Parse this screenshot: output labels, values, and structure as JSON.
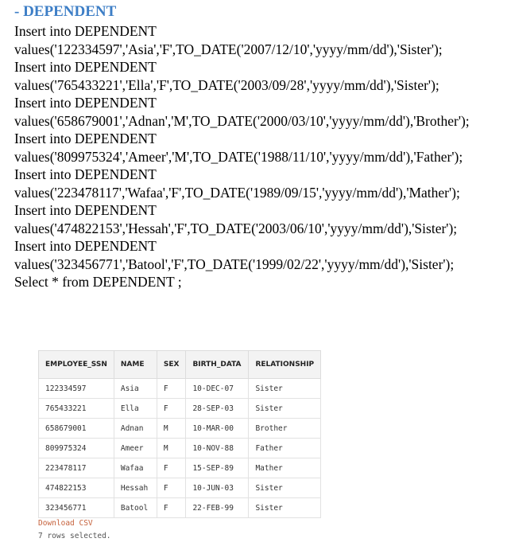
{
  "section": {
    "title": "- DEPENDENT"
  },
  "sql": {
    "lines": [
      "Insert into DEPENDENT",
      "values('122334597','Asia','F',TO_DATE('2007/12/10','yyyy/mm/dd'),'Sister');",
      "Insert into DEPENDENT",
      "values('765433221','Ella','F',TO_DATE('2003/09/28','yyyy/mm/dd'),'Sister');",
      "Insert into DEPENDENT",
      "values('658679001','Adnan','M',TO_DATE('2000/03/10','yyyy/mm/dd'),'Brother');",
      "Insert into DEPENDENT",
      "values('809975324','Ameer','M',TO_DATE('1988/11/10','yyyy/mm/dd'),'Father');",
      "Insert into DEPENDENT",
      "values('223478117','Wafaa','F',TO_DATE('1989/09/15','yyyy/mm/dd'),'Mather');",
      "Insert into DEPENDENT",
      "values('474822153','Hessah','F',TO_DATE('2003/06/10','yyyy/mm/dd'),'Sister');",
      "Insert into DEPENDENT",
      "values('323456771','Batool','F',TO_DATE('1999/02/22','yyyy/mm/dd'),'Sister');",
      "Select * from DEPENDENT ;"
    ]
  },
  "result": {
    "headers": {
      "ssn": "EMPLOYEE_SSN",
      "name": "NAME",
      "sex": "SEX",
      "birth": "BIRTH_DATA",
      "relationship": "RELATIONSHIP"
    },
    "rows": [
      {
        "ssn": "122334597",
        "name": "Asia",
        "sex": "F",
        "birth": "10-DEC-07",
        "relationship": "Sister"
      },
      {
        "ssn": "765433221",
        "name": "Ella",
        "sex": "F",
        "birth": "28-SEP-03",
        "relationship": "Sister"
      },
      {
        "ssn": "658679001",
        "name": "Adnan",
        "sex": "M",
        "birth": "10-MAR-00",
        "relationship": "Brother"
      },
      {
        "ssn": "809975324",
        "name": "Ameer",
        "sex": "M",
        "birth": "10-NOV-88",
        "relationship": "Father"
      },
      {
        "ssn": "223478117",
        "name": "Wafaa",
        "sex": "F",
        "birth": "15-SEP-89",
        "relationship": "Mather"
      },
      {
        "ssn": "474822153",
        "name": "Hessah",
        "sex": "F",
        "birth": "10-JUN-03",
        "relationship": "Sister"
      },
      {
        "ssn": "323456771",
        "name": "Batool",
        "sex": "F",
        "birth": "22-FEB-99",
        "relationship": "Sister"
      }
    ],
    "download_label": "Download CSV",
    "rows_selected": "7 rows selected."
  },
  "colors": {
    "title": "#3d7ec6",
    "download_link": "#c5603a",
    "header_bg": "#f3f3f3"
  }
}
